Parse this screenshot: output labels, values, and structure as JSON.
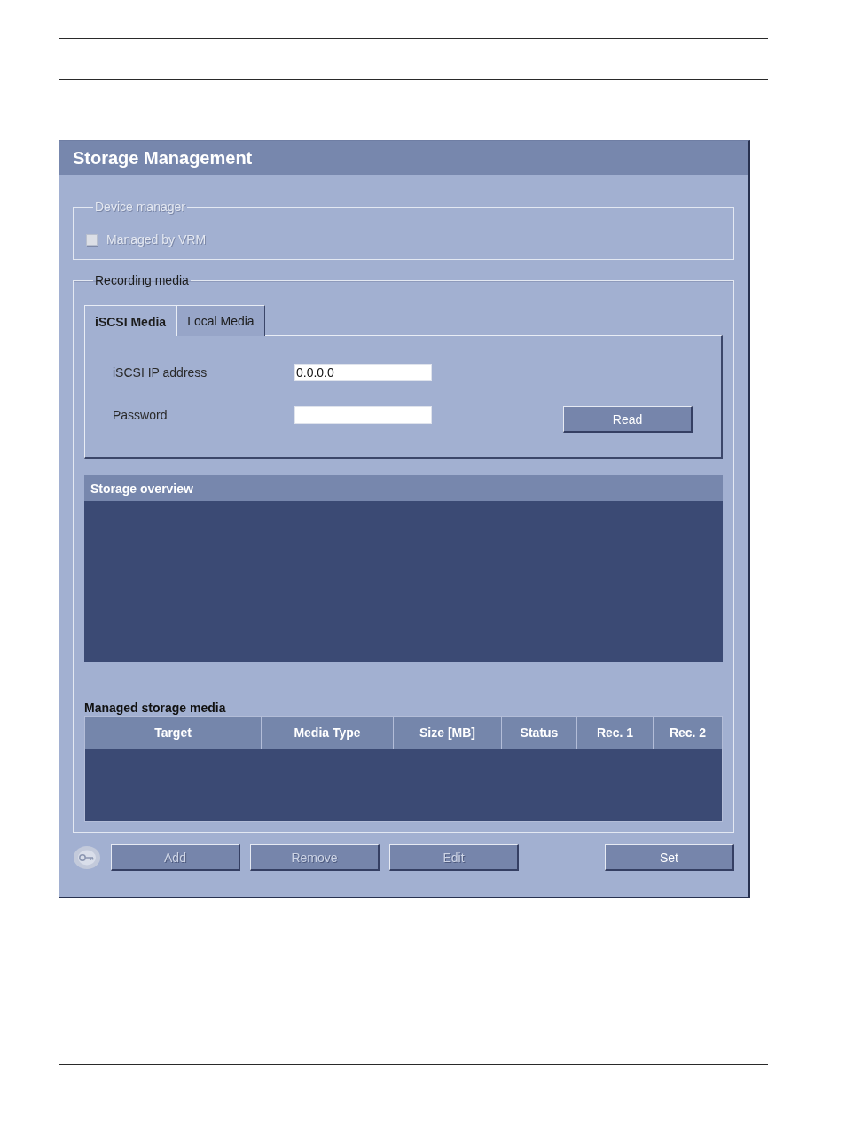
{
  "window": {
    "title": "Storage Management"
  },
  "device_manager": {
    "legend": "Device manager",
    "disabled": true,
    "checkbox": {
      "label": "Managed by VRM",
      "checked": false,
      "disabled": true
    }
  },
  "recording_media": {
    "legend": "Recording media",
    "tabs": [
      {
        "label": "iSCSI Media",
        "selected": true
      },
      {
        "label": "Local Media",
        "selected": false
      }
    ],
    "fields": [
      {
        "label": "iSCSI IP address",
        "value": "0.0.0.0"
      },
      {
        "label": "Password"
      }
    ],
    "read_button": {
      "label": "Read",
      "disabled": false
    },
    "storage_overview": {
      "title": "Storage overview"
    },
    "managed_storage_media": {
      "title": "Managed storage media",
      "columns": [
        "Target",
        "Media Type",
        "Size [MB]",
        "Status",
        "Rec. 1",
        "Rec. 2"
      ]
    }
  },
  "footer": {
    "buttons": [
      {
        "kind": "icon",
        "disabled": true
      },
      {
        "kind": "text",
        "label": "Add",
        "disabled": true
      },
      {
        "kind": "text",
        "label": "Remove",
        "disabled": true
      },
      {
        "kind": "text",
        "label": "Edit",
        "disabled": true
      }
    ],
    "set_button": {
      "label": "Set",
      "disabled": false
    }
  }
}
